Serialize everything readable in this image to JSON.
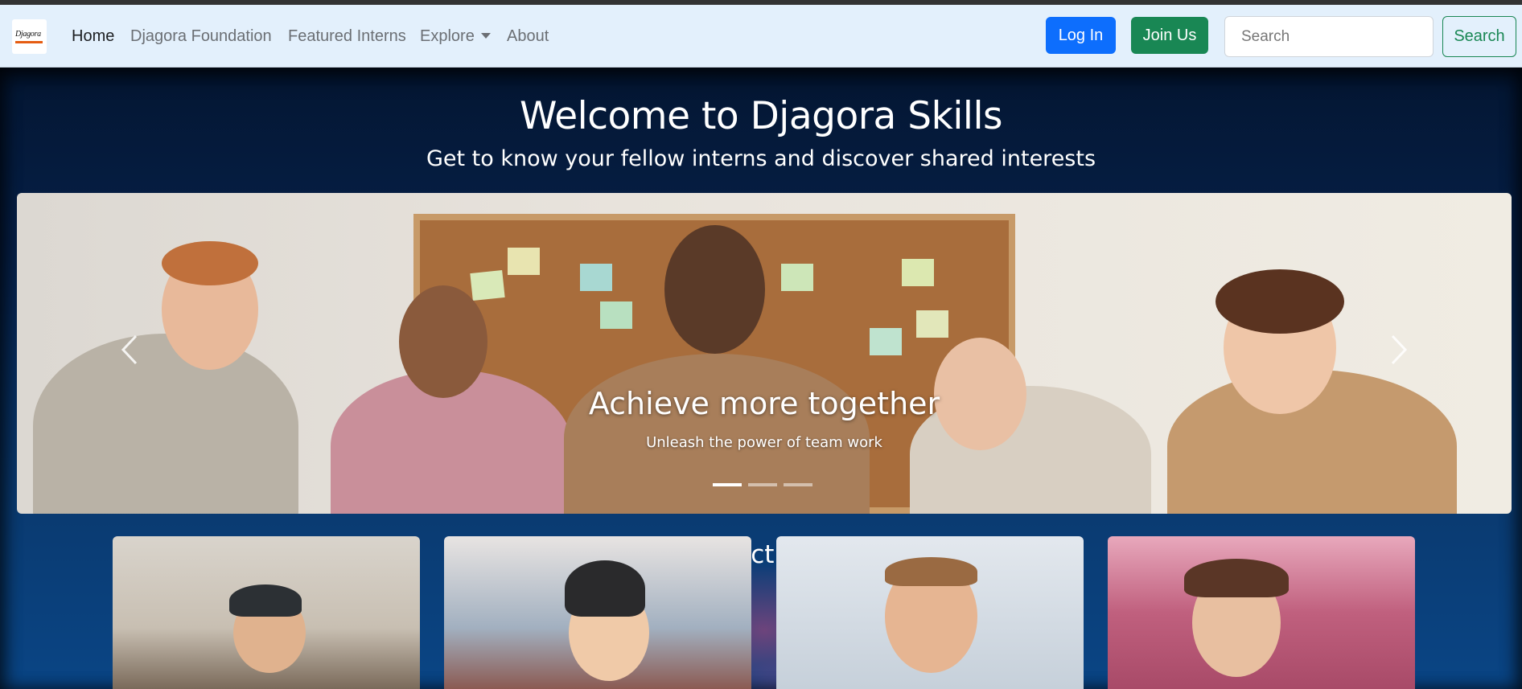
{
  "navbar": {
    "logo_text": "Djagora",
    "links": [
      {
        "label": "Home"
      },
      {
        "label": "Djagora Foundation"
      },
      {
        "label": "Featured Interns"
      },
      {
        "label": "Explore"
      },
      {
        "label": "About"
      }
    ],
    "login_label": "Log In",
    "join_label": "Join Us",
    "search_placeholder": "Search",
    "search_button": "Search"
  },
  "hero": {
    "title": "Welcome to Djagora Skills",
    "subtitle": "Get to know your fellow interns and discover shared interests"
  },
  "carousel": {
    "caption_title": "Achieve more together",
    "caption_subtitle": "Unleash the power of team work",
    "active_slide": 1,
    "slide_count": 3
  },
  "interns_section": {
    "title": "Meet our active interns"
  },
  "colors": {
    "primary": "#0d6efd",
    "success": "#198754",
    "navbar_bg": "#e3f0fc",
    "hero_dark": "#041632"
  }
}
